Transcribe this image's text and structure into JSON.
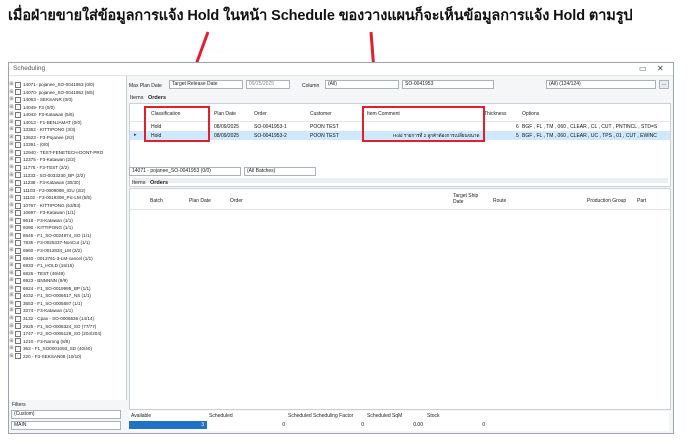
{
  "banner": "เมื่อฝ่ายขายใส่ข้อมูลการแจ้ง Hold ในหน้า Schedule ของวางแผนก็จะเห็นข้อมูลการแจ้ง Hold ตามรูป",
  "window": {
    "title": "Scheduling"
  },
  "tree": [
    "14071- pojanee_SO-0041953 (0/0)",
    "14070- pojanee_SO-0041952 (5/5)",
    "14063 - SEKSANR (0/0)",
    "14049- F3 (0/0)",
    "14042- F3-Katawan (5/5)",
    "14013 - F1-BENJAMAT (0/0)",
    "13362 - KITTIPONG (3/3)",
    "13623 - F3-Pojanee (2/2)",
    "13391 - (0/0)",
    "12940 - TEST-FENETECH-DONT-PRO",
    "12375 - F3-Katawan (2/2)",
    "11775 - F3-TEST (2/2)",
    "11333 - SO-0033230_BP (2/2)",
    "11238 - F3-Katawan (30/30)",
    "11103 - F3-0009098_IGU (2/2)",
    "11102 - F3-0019308_Pic-LM (5/5)",
    "10767 - KITTIPONG (53/53)",
    "10697 - F3-Katawan (1/1)",
    "9618 - F3-Katawan (1/1)",
    "9390 - KITTIPONG (1/1)",
    "8645 - F1_SO-0024874_SO (1/1)",
    "7835 - F3-0025337-NonCut (1/1)",
    "6960 - F3-0012834_LM (2/2)",
    "6940 - 0013761-3-LM-cancel (1/1)",
    "6933 - F1_HOLD (15/15)",
    "6826 - TEST (49/49)",
    "6923 - BNNNNN (9/9)",
    "6924 - F1_SO-0019995_BP (1/1)",
    "4032 - F1_SO-0006517_NS (1/1)",
    "3553 - F1_SO-0005697 (1/1)",
    "3374 - F3-Katawan (1/1)",
    "3132 - Cpax - SO-0006536 (14/14)",
    "2925 - F1_SO-0008324_SO (77/77)",
    "1747 - F2_SO-0005128_SO (204/204)",
    "1210 - F3-Narong (8/8)",
    "363 - F1_SO0001093_SD (40/40)",
    "220 - F3-SEKSAN08 (10/10)"
  ],
  "filters": {
    "label": "Filters",
    "selected": "(Custom)",
    "view": "MAIN"
  },
  "toolbar": {
    "max_plan_date_label": "Max Plan Date",
    "date_type": "Target Release Date",
    "date_value": "09/25/2025",
    "column_label": "Column",
    "column_value": "(All)",
    "search_value": "SO-0041953",
    "filter_value": "(All) (124/124)"
  },
  "tabs_top": [
    "Items",
    "Orders"
  ],
  "orders_table": {
    "columns": [
      "Classification",
      "Plan Date",
      "Order",
      "Customer",
      "Item Comment",
      "Thickness",
      "Options"
    ],
    "rows": [
      {
        "classification": "Hold",
        "plan_date": "08/09/2025",
        "order": "SO-0041953-1",
        "customer": "POON TEST",
        "comment": "",
        "thickness": "6",
        "options": "BGF , FL , TM , 060 , CLEAR , CL , CUT , PNTINCL , STD=S"
      },
      {
        "classification": "Hold",
        "plan_date": "08/09/2025",
        "order": "SO-0041953-2",
        "customer": "POON TEST",
        "comment": "Hold รายการที่ 2 ลูกค้าต้องการเปลี่ยนขนาด",
        "thickness": "5",
        "options": "BGF , FL , TM , 060 , CLEAR , UC , TPS , 01 , CUT , EWINC"
      }
    ]
  },
  "batch_bar": {
    "order_combo": "14071 - pojanee_SO-0041953 (0/0)",
    "batch_combo": "(All Batches)"
  },
  "tabs_bottom": [
    "Items",
    "Orders"
  ],
  "batch_table": {
    "columns": [
      "Batch",
      "Plan Date",
      "Order",
      "Target Ship Date",
      "Route",
      "Production Group",
      "Part"
    ]
  },
  "status": {
    "labels": [
      "Available",
      "Scheduled",
      "Scheduled Scheduling Factor",
      "Scheduled SqM",
      "Stock"
    ],
    "values": [
      "3",
      "0",
      "0",
      "0.00",
      "0"
    ]
  },
  "colors": {
    "highlight": "#e0202e",
    "selected_row": "#cfe8fb",
    "status_bar": "#1e73c8"
  }
}
